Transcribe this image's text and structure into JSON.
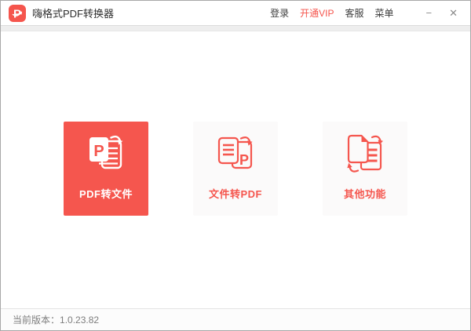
{
  "window": {
    "app_title": "嗨格式PDF转换器",
    "logo_letter": "P",
    "minimize_glyph": "−",
    "close_glyph": "✕"
  },
  "menu": {
    "login": "登录",
    "vip": "开通VIP",
    "support": "客服",
    "menu": "菜单"
  },
  "cards": [
    {
      "label": "PDF转文件",
      "icon": "pdf-to-file-icon",
      "icon_letter": "P",
      "selected": true
    },
    {
      "label": "文件转PDF",
      "icon": "file-to-pdf-icon",
      "icon_letter": "P",
      "selected": false
    },
    {
      "label": "其他功能",
      "icon": "other-functions-icon",
      "selected": false
    }
  ],
  "footer": {
    "version_label": "当前版本：",
    "version": "1.0.23.82"
  },
  "colors": {
    "accent": "#f5564e",
    "vip_text": "#f5544c",
    "card_light_bg": "#fbfafa",
    "title_text": "#2e2e2e",
    "footer_text": "#7d7d7d",
    "strip_bg": "#eeeeee"
  }
}
